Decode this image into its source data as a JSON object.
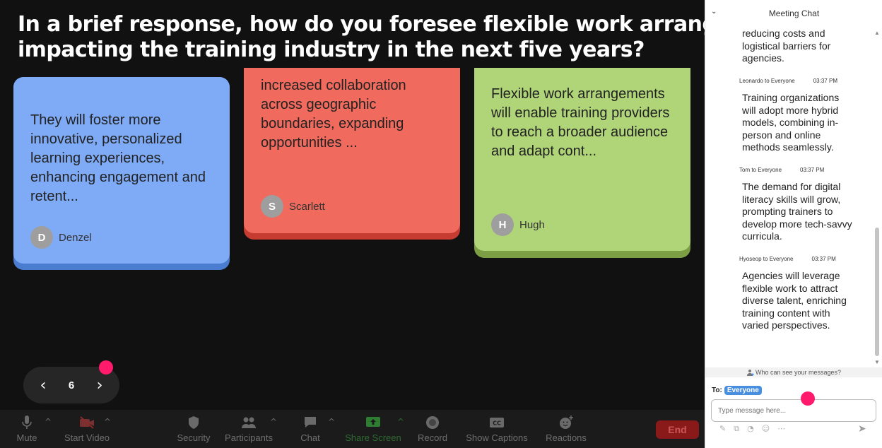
{
  "question": {
    "line1": "In a brief response, how do you foresee flexible work arrangements",
    "line2": "impacting the training industry in the next five years?"
  },
  "cards": [
    {
      "text": "They will foster more innovative, personalized learning experiences, enhancing engagement and retent...",
      "initial": "D",
      "author": "Denzel",
      "color": "#7eaaf6"
    },
    {
      "text": "increased collaboration across geographic boundaries, expanding opportunities ...",
      "initial": "S",
      "author": "Scarlett",
      "color": "#f06a5e"
    },
    {
      "text": "Flexible work arrangements will enable training providers to reach a broader audience and adapt cont...",
      "initial": "H",
      "author": "Hugh",
      "color": "#b0d579"
    }
  ],
  "pager": {
    "prev": "‹",
    "page": "6",
    "next": "›"
  },
  "toolbar": {
    "mute": "Mute",
    "start_video": "Start Video",
    "security": "Security",
    "participants": "Participants",
    "chat": "Chat",
    "share_screen": "Share Screen",
    "record": "Record",
    "show_captions": "Show Captions",
    "reactions": "Reactions",
    "end": "End"
  },
  "chat": {
    "title": "Meeting Chat",
    "messages": [
      {
        "meta_name": "",
        "meta_time": "",
        "text": "reducing costs and logistical barriers for agencies."
      },
      {
        "meta_name": "Leonardo to Everyone",
        "meta_time": "03:37 PM",
        "text": "Training organizations will adopt more hybrid models, combining in-person and online methods seamlessly."
      },
      {
        "meta_name": "Tom to Everyone",
        "meta_time": "03:37 PM",
        "text": "The demand for digital literacy skills will grow, prompting trainers to develop more tech-savvy curricula."
      },
      {
        "meta_name": "Hyoseop to Everyone",
        "meta_time": "03:37 PM",
        "text": "Agencies will leverage flexible work to attract diverse talent, enriching training content with varied perspectives."
      }
    ],
    "who_can_see": "Who can see your messages?",
    "to_label": "To:",
    "to_value": "Everyone",
    "input_placeholder": "Type message here..."
  },
  "colors": {
    "accent_pink": "#ff1a6b",
    "end_red": "#8a1a1a",
    "share_green": "#2e7d32"
  }
}
